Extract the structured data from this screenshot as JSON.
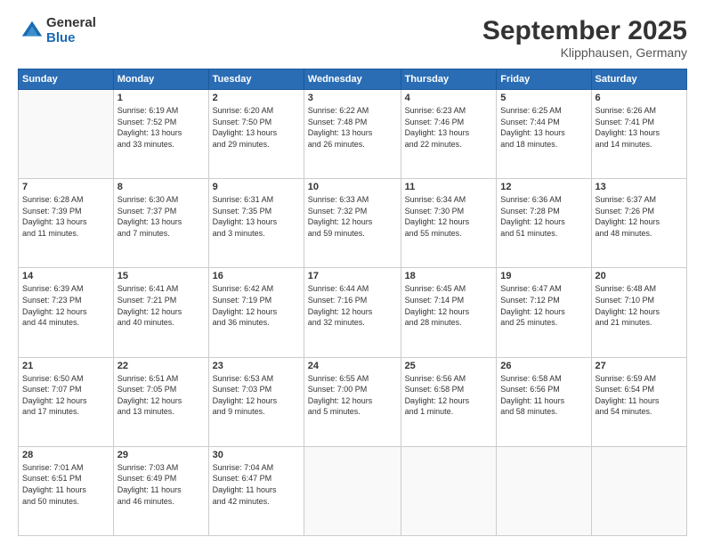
{
  "header": {
    "logo_general": "General",
    "logo_blue": "Blue",
    "month_title": "September 2025",
    "location": "Klipphausen, Germany"
  },
  "days_of_week": [
    "Sunday",
    "Monday",
    "Tuesday",
    "Wednesday",
    "Thursday",
    "Friday",
    "Saturday"
  ],
  "weeks": [
    [
      {
        "day": "",
        "info": ""
      },
      {
        "day": "1",
        "info": "Sunrise: 6:19 AM\nSunset: 7:52 PM\nDaylight: 13 hours\nand 33 minutes."
      },
      {
        "day": "2",
        "info": "Sunrise: 6:20 AM\nSunset: 7:50 PM\nDaylight: 13 hours\nand 29 minutes."
      },
      {
        "day": "3",
        "info": "Sunrise: 6:22 AM\nSunset: 7:48 PM\nDaylight: 13 hours\nand 26 minutes."
      },
      {
        "day": "4",
        "info": "Sunrise: 6:23 AM\nSunset: 7:46 PM\nDaylight: 13 hours\nand 22 minutes."
      },
      {
        "day": "5",
        "info": "Sunrise: 6:25 AM\nSunset: 7:44 PM\nDaylight: 13 hours\nand 18 minutes."
      },
      {
        "day": "6",
        "info": "Sunrise: 6:26 AM\nSunset: 7:41 PM\nDaylight: 13 hours\nand 14 minutes."
      }
    ],
    [
      {
        "day": "7",
        "info": "Sunrise: 6:28 AM\nSunset: 7:39 PM\nDaylight: 13 hours\nand 11 minutes."
      },
      {
        "day": "8",
        "info": "Sunrise: 6:30 AM\nSunset: 7:37 PM\nDaylight: 13 hours\nand 7 minutes."
      },
      {
        "day": "9",
        "info": "Sunrise: 6:31 AM\nSunset: 7:35 PM\nDaylight: 13 hours\nand 3 minutes."
      },
      {
        "day": "10",
        "info": "Sunrise: 6:33 AM\nSunset: 7:32 PM\nDaylight: 12 hours\nand 59 minutes."
      },
      {
        "day": "11",
        "info": "Sunrise: 6:34 AM\nSunset: 7:30 PM\nDaylight: 12 hours\nand 55 minutes."
      },
      {
        "day": "12",
        "info": "Sunrise: 6:36 AM\nSunset: 7:28 PM\nDaylight: 12 hours\nand 51 minutes."
      },
      {
        "day": "13",
        "info": "Sunrise: 6:37 AM\nSunset: 7:26 PM\nDaylight: 12 hours\nand 48 minutes."
      }
    ],
    [
      {
        "day": "14",
        "info": "Sunrise: 6:39 AM\nSunset: 7:23 PM\nDaylight: 12 hours\nand 44 minutes."
      },
      {
        "day": "15",
        "info": "Sunrise: 6:41 AM\nSunset: 7:21 PM\nDaylight: 12 hours\nand 40 minutes."
      },
      {
        "day": "16",
        "info": "Sunrise: 6:42 AM\nSunset: 7:19 PM\nDaylight: 12 hours\nand 36 minutes."
      },
      {
        "day": "17",
        "info": "Sunrise: 6:44 AM\nSunset: 7:16 PM\nDaylight: 12 hours\nand 32 minutes."
      },
      {
        "day": "18",
        "info": "Sunrise: 6:45 AM\nSunset: 7:14 PM\nDaylight: 12 hours\nand 28 minutes."
      },
      {
        "day": "19",
        "info": "Sunrise: 6:47 AM\nSunset: 7:12 PM\nDaylight: 12 hours\nand 25 minutes."
      },
      {
        "day": "20",
        "info": "Sunrise: 6:48 AM\nSunset: 7:10 PM\nDaylight: 12 hours\nand 21 minutes."
      }
    ],
    [
      {
        "day": "21",
        "info": "Sunrise: 6:50 AM\nSunset: 7:07 PM\nDaylight: 12 hours\nand 17 minutes."
      },
      {
        "day": "22",
        "info": "Sunrise: 6:51 AM\nSunset: 7:05 PM\nDaylight: 12 hours\nand 13 minutes."
      },
      {
        "day": "23",
        "info": "Sunrise: 6:53 AM\nSunset: 7:03 PM\nDaylight: 12 hours\nand 9 minutes."
      },
      {
        "day": "24",
        "info": "Sunrise: 6:55 AM\nSunset: 7:00 PM\nDaylight: 12 hours\nand 5 minutes."
      },
      {
        "day": "25",
        "info": "Sunrise: 6:56 AM\nSunset: 6:58 PM\nDaylight: 12 hours\nand 1 minute."
      },
      {
        "day": "26",
        "info": "Sunrise: 6:58 AM\nSunset: 6:56 PM\nDaylight: 11 hours\nand 58 minutes."
      },
      {
        "day": "27",
        "info": "Sunrise: 6:59 AM\nSunset: 6:54 PM\nDaylight: 11 hours\nand 54 minutes."
      }
    ],
    [
      {
        "day": "28",
        "info": "Sunrise: 7:01 AM\nSunset: 6:51 PM\nDaylight: 11 hours\nand 50 minutes."
      },
      {
        "day": "29",
        "info": "Sunrise: 7:03 AM\nSunset: 6:49 PM\nDaylight: 11 hours\nand 46 minutes."
      },
      {
        "day": "30",
        "info": "Sunrise: 7:04 AM\nSunset: 6:47 PM\nDaylight: 11 hours\nand 42 minutes."
      },
      {
        "day": "",
        "info": ""
      },
      {
        "day": "",
        "info": ""
      },
      {
        "day": "",
        "info": ""
      },
      {
        "day": "",
        "info": ""
      }
    ]
  ]
}
